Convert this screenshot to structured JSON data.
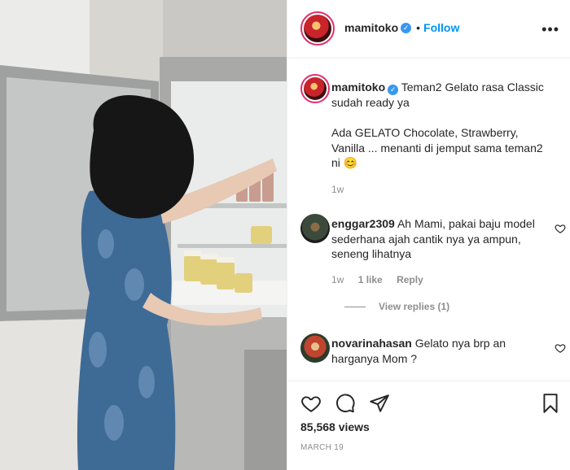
{
  "post": {
    "username": "mamitoko",
    "follow_label": "Follow",
    "dot": "•",
    "more": "•••",
    "views": "85,568 views",
    "date": "MARCH 19"
  },
  "caption": {
    "username": "mamitoko",
    "line1": "Teman2 Gelato rasa Classic sudah ready ya",
    "line2": "Ada GELATO Chocolate, Strawberry, Vanilla ... menanti di jemput sama teman2 ni 😊",
    "time": "1w"
  },
  "comments": [
    {
      "username": "enggar2309",
      "text": "Ah Mami, pakai baju model sederhana ajah cantik nya ya ampun, seneng lihatnya",
      "time": "1w",
      "likes": "1 like",
      "reply": "Reply",
      "view_replies": "View replies (1)"
    },
    {
      "username": "novarinahasan",
      "text": "Gelato nya brp an harganya Mom ?"
    }
  ],
  "icons": {
    "like": "heart-icon",
    "comment": "comment-icon",
    "share": "share-icon",
    "save": "bookmark-icon"
  },
  "colors": {
    "link": "#0095f6",
    "verified": "#3897f0",
    "muted": "#8e8e8e"
  }
}
